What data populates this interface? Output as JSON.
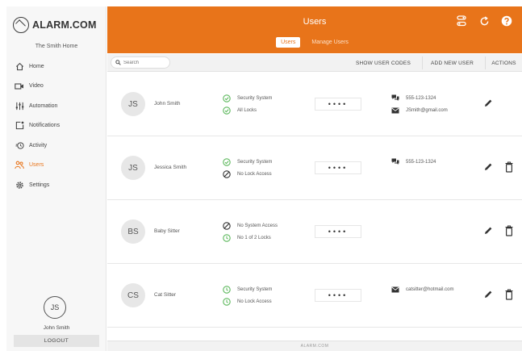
{
  "brand": {
    "name": "ALARM.COM",
    "accent": "#e8741a"
  },
  "sidebar": {
    "home_name": "The Smith Home",
    "items": [
      {
        "label": "Home",
        "icon": "home-icon"
      },
      {
        "label": "Video",
        "icon": "video-icon"
      },
      {
        "label": "Automation",
        "icon": "automation-icon"
      },
      {
        "label": "Notifications",
        "icon": "notifications-icon"
      },
      {
        "label": "Activity",
        "icon": "activity-icon"
      },
      {
        "label": "Users",
        "icon": "users-icon",
        "active": true
      },
      {
        "label": "Settings",
        "icon": "gear-icon"
      }
    ],
    "user_initials": "JS",
    "user_name": "John Smith",
    "logout_label": "LOGOUT"
  },
  "header": {
    "title": "Users",
    "tabs": [
      {
        "label": "Users",
        "active": true
      },
      {
        "label": "Manage Users"
      }
    ],
    "icons": [
      "switch-icon",
      "refresh-icon",
      "help-icon"
    ]
  },
  "toolbar": {
    "search_placeholder": "Search",
    "show_codes_label": "SHOW USER CODES",
    "add_user_label": "ADD NEW USER",
    "actions_label": "ACTIONS"
  },
  "users": [
    {
      "initials": "JS",
      "name": "John Smith",
      "access": [
        {
          "icon": "check-icon",
          "text": "Security System"
        },
        {
          "icon": "check-icon",
          "text": "All Locks"
        }
      ],
      "pin": "••••",
      "contacts": [
        {
          "icon": "phone-icon",
          "text": "555-123-1324"
        },
        {
          "icon": "email-icon",
          "text": "JSmith@gmail.com"
        }
      ],
      "deletable": false
    },
    {
      "initials": "JS",
      "name": "Jessica Smith",
      "access": [
        {
          "icon": "check-icon",
          "text": "Security System"
        },
        {
          "icon": "no-access-icon",
          "text": "No Lock Access"
        }
      ],
      "pin": "••••",
      "contacts": [
        {
          "icon": "phone-icon",
          "text": "555-123-1324"
        }
      ],
      "deletable": true
    },
    {
      "initials": "BS",
      "name": "Baby Sitter",
      "access": [
        {
          "icon": "no-access-icon",
          "text": "No System Access"
        },
        {
          "icon": "clock-icon",
          "text": "No 1 of 2 Locks"
        }
      ],
      "pin": "••••",
      "contacts": [],
      "deletable": true
    },
    {
      "initials": "CS",
      "name": "Cat Sitter",
      "access": [
        {
          "icon": "clock-icon",
          "text": "Security System"
        },
        {
          "icon": "clock-icon",
          "text": "No Lock Access"
        }
      ],
      "pin": "••••",
      "contacts": [
        {
          "icon": "email-icon",
          "text": "catsitter@hotmail.com"
        }
      ],
      "deletable": true
    }
  ],
  "footer": {
    "logo": "ALARM.COM"
  }
}
